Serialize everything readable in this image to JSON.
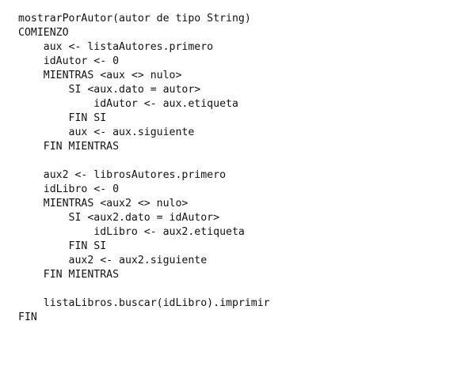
{
  "document": {
    "lines": [
      "mostrarPorAutor(autor de tipo String)",
      "COMIENZO",
      "    aux <- listaAutores.primero",
      "    idAutor <- 0",
      "    MIENTRAS <aux <> nulo>",
      "        SI <aux.dato = autor>",
      "            idAutor <- aux.etiqueta",
      "        FIN SI",
      "        aux <- aux.siguiente",
      "    FIN MIENTRAS",
      "",
      "    aux2 <- librosAutores.primero",
      "    idLibro <- 0",
      "    MIENTRAS <aux2 <> nulo>",
      "        SI <aux2.dato = idAutor>",
      "            idLibro <- aux2.etiqueta",
      "        FIN SI",
      "        aux2 <- aux2.siguiente",
      "    FIN MIENTRAS",
      "",
      "    listaLibros.buscar(idLibro).imprimir",
      "FIN"
    ]
  }
}
